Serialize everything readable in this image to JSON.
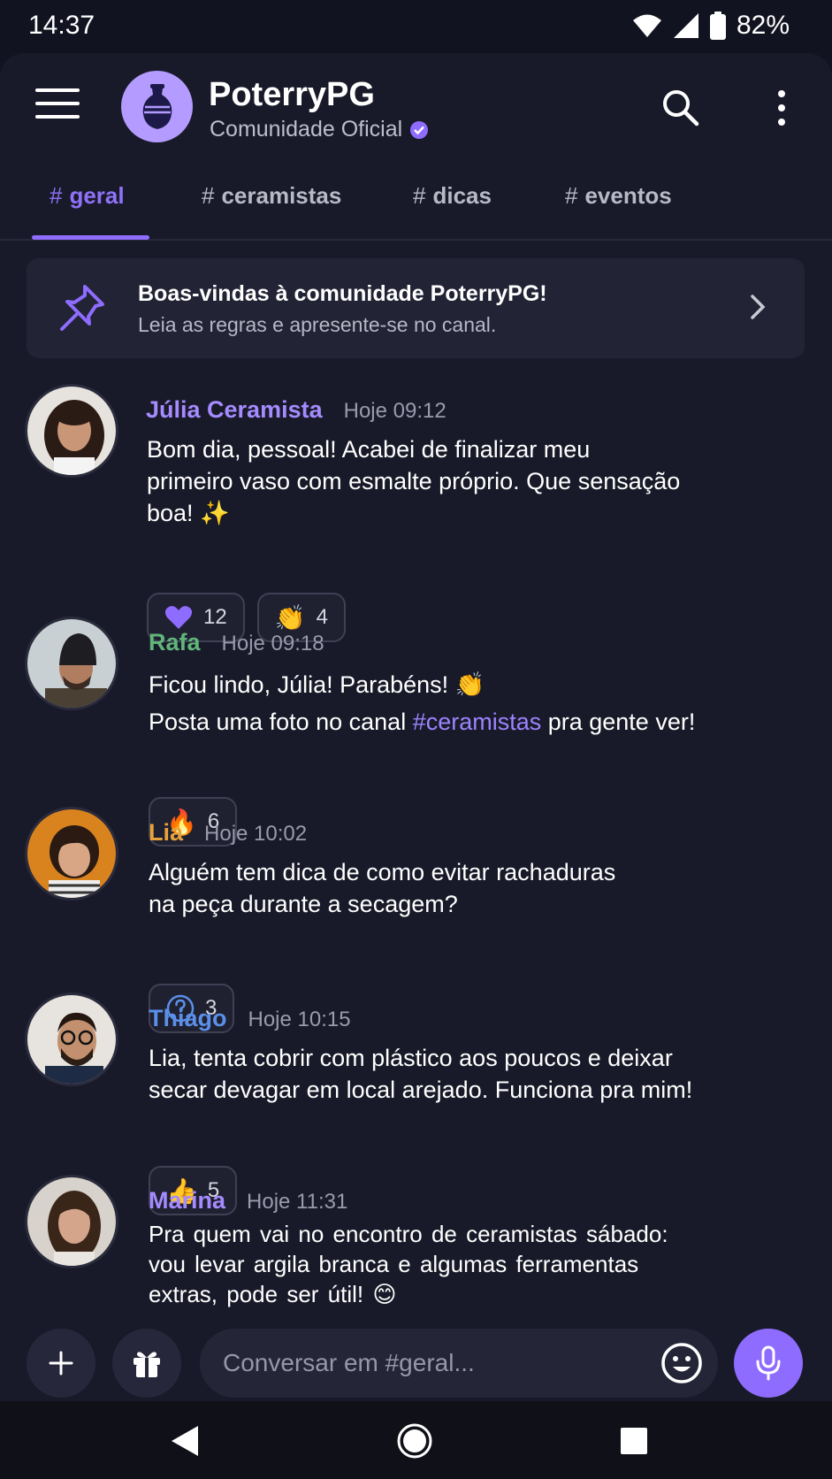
{
  "status": {
    "time": "14:37",
    "battery": "82%"
  },
  "header": {
    "title": "PoterryPG",
    "subtitle": "Comunidade Oficial"
  },
  "tabs": [
    {
      "label": "geral",
      "active": true
    },
    {
      "label": "ceramistas",
      "active": false
    },
    {
      "label": "dicas",
      "active": false
    },
    {
      "label": "eventos",
      "active": false
    }
  ],
  "tab_hash": "#",
  "banner": {
    "title": "Boas-vindas à comunidade PoterryPG!",
    "subtitle": "Leia as regras e apresente-se no canal."
  },
  "messages": [
    {
      "user": "Júlia Ceramista",
      "user_color": "#a58bff",
      "time": "Hoje 09:12",
      "lines": [
        "Bom dia, pessoal! Acabei de finalizar meu",
        "primeiro vaso com esmalte próprio. Que sensação",
        "boa! ✨"
      ],
      "reactions": [
        {
          "icon": "purple-heart",
          "count": "12"
        },
        {
          "icon": "clapping-hands",
          "count": "4"
        }
      ]
    },
    {
      "user": "Rafa",
      "user_color": "#5fb57a",
      "time": "Hoje 09:18",
      "line1": "Ficou lindo, Júlia! Parabéns! 👏",
      "line2_before": "Posta uma foto no canal ",
      "line2_channel": "#ceramistas",
      "line2_after": " pra gente ver!",
      "reactions": [
        {
          "icon": "fire",
          "count": "6"
        }
      ]
    },
    {
      "user": "Lia",
      "user_color": "#e7a33a",
      "time": "Hoje 10:02",
      "lines": [
        "Alguém tem dica de como evitar rachaduras",
        "na peça durante a secagem?"
      ],
      "reactions": [
        {
          "icon": "question-circle",
          "count": "3"
        }
      ]
    },
    {
      "user": "Thiago",
      "user_color": "#5b8fe8",
      "time": "Hoje 10:15",
      "lines": [
        "Lia, tenta cobrir com plástico aos poucos e deixar",
        "secar devagar em local arejado. Funciona pra mim!"
      ],
      "reactions": [
        {
          "icon": "thumbs-up",
          "count": "5"
        }
      ]
    },
    {
      "user": "Marina",
      "user_color": "#a58bff",
      "time": "Hoje 11:31",
      "lines": [
        "Pra quem vai no encontro de ceramistas sábado:",
        "vou levar argila branca e algumas ferramentas",
        "extras, pode ser útil! 😊"
      ]
    }
  ],
  "composer": {
    "placeholder": "Conversar em #geral..."
  },
  "colors": {
    "accent": "#8e6cff",
    "background": "#191a29"
  }
}
